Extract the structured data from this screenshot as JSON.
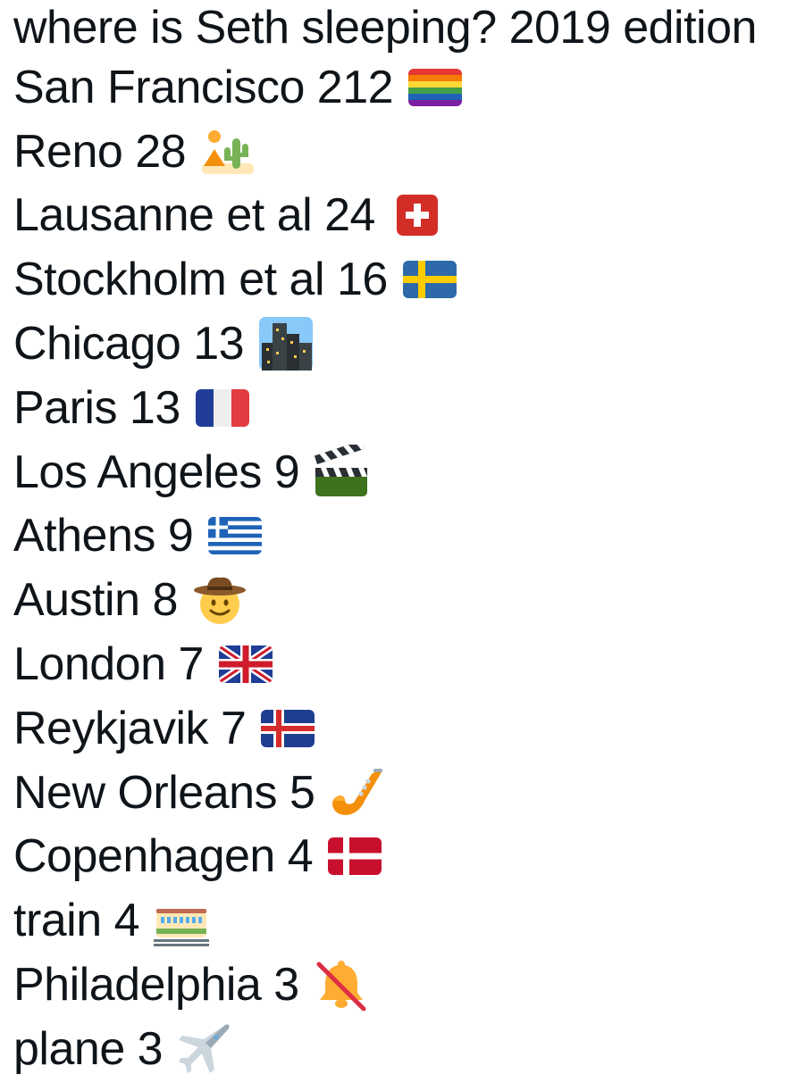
{
  "post": {
    "title": "where is Seth sleeping? 2019 edition",
    "entries": [
      {
        "label": "San Francisco 212",
        "icon": "rainbow-flag-icon"
      },
      {
        "label": "Reno 28",
        "icon": "desert-icon"
      },
      {
        "label": "Lausanne et al 24",
        "icon": "swiss-flag-icon"
      },
      {
        "label": "Stockholm et al 16",
        "icon": "swedish-flag-icon"
      },
      {
        "label": "Chicago 13",
        "icon": "night-city-icon"
      },
      {
        "label": "Paris 13",
        "icon": "french-flag-icon"
      },
      {
        "label": "Los Angeles 9",
        "icon": "clapper-board-icon"
      },
      {
        "label": "Athens 9",
        "icon": "greek-flag-icon"
      },
      {
        "label": "Austin 8",
        "icon": "cowboy-face-icon"
      },
      {
        "label": "London 7",
        "icon": "uk-flag-icon"
      },
      {
        "label": "Reykjavik 7",
        "icon": "iceland-flag-icon"
      },
      {
        "label": "New Orleans 5",
        "icon": "saxophone-icon"
      },
      {
        "label": "Copenhagen 4",
        "icon": "danish-flag-icon"
      },
      {
        "label": "train 4",
        "icon": "railway-car-icon"
      },
      {
        "label": "Philadelphia 3",
        "icon": "bell-slash-icon"
      },
      {
        "label": "plane 3",
        "icon": "airplane-icon"
      }
    ]
  }
}
